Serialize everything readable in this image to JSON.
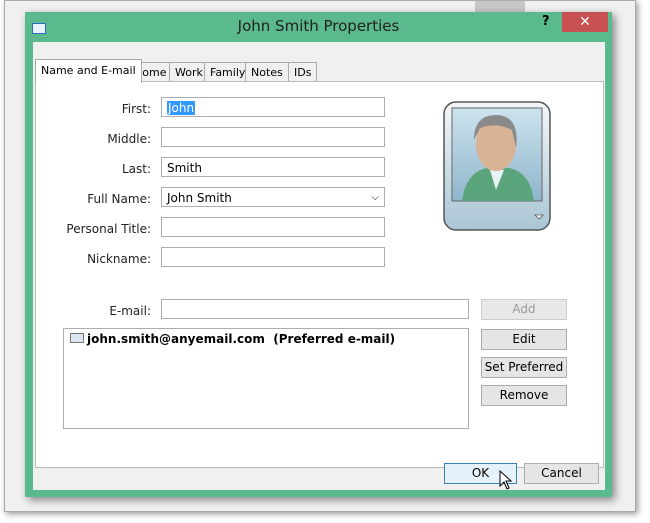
{
  "dialog": {
    "title": "John Smith Properties",
    "help": "?",
    "close": "✕"
  },
  "tabs": [
    "Name and E-mail",
    "Home",
    "Work",
    "Family",
    "Notes",
    "IDs"
  ],
  "fields": [
    {
      "label": "First:",
      "value": "John"
    },
    {
      "label": "Middle:",
      "value": ""
    },
    {
      "label": "Last:",
      "value": "Smith"
    },
    {
      "label": "Full Name:",
      "value": "John Smith"
    },
    {
      "label": "Personal Title:",
      "value": ""
    },
    {
      "label": "Nickname:",
      "value": ""
    }
  ],
  "email": {
    "label": "E-mail:",
    "value": "",
    "list": [
      {
        "address": "john.smith@anyemail.com",
        "note": "(Preferred e-mail)"
      }
    ]
  },
  "buttons": {
    "add": "Add",
    "edit": "Edit",
    "set_preferred": "Set Preferred",
    "remove": "Remove",
    "ok": "OK",
    "cancel": "Cancel"
  }
}
